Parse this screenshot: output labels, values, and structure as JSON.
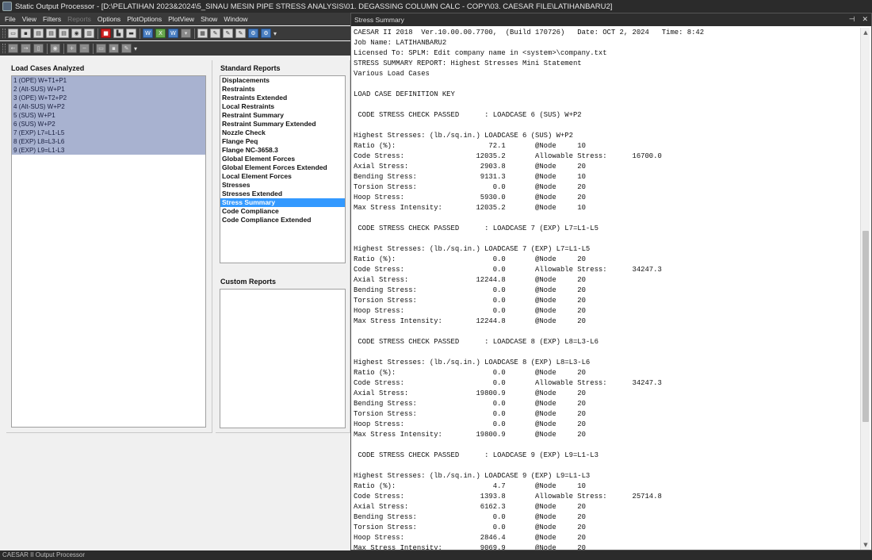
{
  "window": {
    "title": "Static Output Processor - [D:\\PELATIHAN 2023&2024\\5_SINAU MESIN PIPE STRESS ANALYSIS\\01. DEGASSING COLUMN CALC - COPY\\03. CAESAR FILE\\LATIHANBARU2]"
  },
  "menu": [
    {
      "label": "File",
      "enabled": true
    },
    {
      "label": "View",
      "enabled": true
    },
    {
      "label": "Filters",
      "enabled": true
    },
    {
      "label": "Reports",
      "enabled": false
    },
    {
      "label": "Options",
      "enabled": true
    },
    {
      "label": "PlotOptions",
      "enabled": true
    },
    {
      "label": "PlotView",
      "enabled": true
    },
    {
      "label": "Show",
      "enabled": true
    },
    {
      "label": "Window",
      "enabled": true
    }
  ],
  "load_cases": {
    "title": "Load Cases Analyzed",
    "items": [
      "1 (OPE) W+T1+P1",
      "2 (Alt-SUS) W+P1",
      "3 (OPE) W+T2+P2",
      "4 (Alt-SUS) W+P2",
      "5 (SUS) W+P1",
      "6 (SUS) W+P2",
      "7 (EXP) L7=L1-L5",
      "8 (EXP) L8=L3-L6",
      "9 (EXP) L9=L1-L3"
    ]
  },
  "standard_reports": {
    "title": "Standard Reports",
    "selected": "Stress Summary",
    "items": [
      "Displacements",
      "Restraints",
      "Restraints Extended",
      "Local Restraints",
      "Restraint Summary",
      "Restraint Summary Extended",
      "Nozzle Check",
      "Flange Peq",
      "Flange NC-3658.3",
      "Global Element Forces",
      "Global Element Forces Extended",
      "Local Element Forces",
      "Stresses",
      "Stresses Extended",
      "Stress Summary",
      "Code Compliance",
      "Code Compliance Extended"
    ]
  },
  "custom_reports": {
    "title": "Custom Reports"
  },
  "report_window": {
    "title": "Stress Summary",
    "pin_glyph": "⊣",
    "close_glyph": "✕",
    "scroll": {
      "position": 0.62,
      "visible_fraction": 0.38
    },
    "lines": [
      "CAESAR II 2018  Ver.10.00.00.7700,  (Build 170726)   Date: OCT 2, 2024   Time: 8:42",
      "Job Name: LATIHANBARU2",
      "Licensed To: SPLM: Edit company name in <system>\\company.txt",
      "STRESS SUMMARY REPORT: Highest Stresses Mini Statement",
      "Various Load Cases",
      "",
      "LOAD CASE DEFINITION KEY",
      "",
      " CODE STRESS CHECK PASSED      : LOADCASE 6 (SUS) W+P2",
      "",
      "Highest Stresses: (lb./sq.in.) LOADCASE 6 (SUS) W+P2",
      "Ratio (%):                      72.1       @Node     10",
      "Code Stress:                 12035.2       Allowable Stress:      16700.0",
      "Axial Stress:                 2903.8       @Node     20",
      "Bending Stress:               9131.3       @Node     10",
      "Torsion Stress:                  0.0       @Node     20",
      "Hoop Stress:                  5930.0       @Node     20",
      "Max Stress Intensity:        12035.2       @Node     10",
      "",
      " CODE STRESS CHECK PASSED      : LOADCASE 7 (EXP) L7=L1-L5",
      "",
      "Highest Stresses: (lb./sq.in.) LOADCASE 7 (EXP) L7=L1-L5",
      "Ratio (%):                       0.0       @Node     20",
      "Code Stress:                     0.0       Allowable Stress:      34247.3",
      "Axial Stress:                12244.8       @Node     20",
      "Bending Stress:                  0.0       @Node     20",
      "Torsion Stress:                  0.0       @Node     20",
      "Hoop Stress:                     0.0       @Node     20",
      "Max Stress Intensity:        12244.8       @Node     20",
      "",
      " CODE STRESS CHECK PASSED      : LOADCASE 8 (EXP) L8=L3-L6",
      "",
      "Highest Stresses: (lb./sq.in.) LOADCASE 8 (EXP) L8=L3-L6",
      "Ratio (%):                       0.0       @Node     20",
      "Code Stress:                     0.0       Allowable Stress:      34247.3",
      "Axial Stress:                19800.9       @Node     20",
      "Bending Stress:                  0.0       @Node     20",
      "Torsion Stress:                  0.0       @Node     20",
      "Hoop Stress:                     0.0       @Node     20",
      "Max Stress Intensity:        19800.9       @Node     20",
      "",
      " CODE STRESS CHECK PASSED      : LOADCASE 9 (EXP) L9=L1-L3",
      "",
      "Highest Stresses: (lb./sq.in.) LOADCASE 9 (EXP) L9=L1-L3",
      "Ratio (%):                       4.7       @Node     10",
      "Code Stress:                  1393.8       Allowable Stress:      25714.8",
      "Axial Stress:                 6162.3       @Node     20",
      "Bending Stress:                  0.0       @Node     20",
      "Torsion Stress:                  0.0       @Node     20",
      "Hoop Stress:                  2846.4       @Node     20",
      "Max Stress Intensity:         9069.9       @Node     20"
    ]
  },
  "statusbar": {
    "text": "CAESAR II Output Processor"
  },
  "toolbar": {
    "row1": [
      {
        "icon": "open-folder-icon",
        "glyph": "▭",
        "style": ""
      },
      {
        "icon": "save-icon",
        "glyph": "▪",
        "style": ""
      },
      {
        "icon": "document-icon",
        "glyph": "▤",
        "style": ""
      },
      {
        "icon": "document-icon",
        "glyph": "▤",
        "style": ""
      },
      {
        "icon": "document-icon",
        "glyph": "▤",
        "style": ""
      },
      {
        "icon": "binoculars-icon",
        "glyph": "◉",
        "style": ""
      },
      {
        "icon": "report-icon",
        "glyph": "▥",
        "style": ""
      },
      {
        "icon": "stop-icon",
        "glyph": "■",
        "style": "red"
      },
      {
        "icon": "chart-icon",
        "glyph": "▙",
        "style": ""
      },
      {
        "icon": "print-icon",
        "glyph": "▬",
        "style": ""
      },
      {
        "icon": "word-icon",
        "glyph": "W",
        "style": "blue"
      },
      {
        "icon": "excel-icon",
        "glyph": "X",
        "style": "green"
      },
      {
        "icon": "word-doc-icon",
        "glyph": "W",
        "style": "blue"
      },
      {
        "icon": "dropdown-icon",
        "glyph": "▾",
        "style": "gray"
      },
      {
        "icon": "report-icon",
        "glyph": "▦",
        "style": ""
      },
      {
        "icon": "edit-icon",
        "glyph": "✎",
        "style": ""
      },
      {
        "icon": "edit-icon",
        "glyph": "✎",
        "style": ""
      },
      {
        "icon": "edit-icon",
        "glyph": "✎",
        "style": ""
      },
      {
        "icon": "tools-icon",
        "glyph": "⚙",
        "style": "blue"
      },
      {
        "icon": "tools-icon",
        "glyph": "⚙",
        "style": "blue"
      }
    ],
    "row2": [
      {
        "icon": "back-arrow-icon",
        "glyph": "←",
        "style": "gray"
      },
      {
        "icon": "forward-arrow-icon",
        "glyph": "→",
        "style": "gray"
      },
      {
        "icon": "page-icon",
        "glyph": "▯",
        "style": "gray"
      },
      {
        "icon": "binoculars-icon",
        "glyph": "◉",
        "style": "gray"
      },
      {
        "icon": "plus-icon",
        "glyph": "+",
        "style": "gray"
      },
      {
        "icon": "minus-icon",
        "glyph": "−",
        "style": "gray"
      },
      {
        "icon": "window-icon",
        "glyph": "▭",
        "style": "gray"
      },
      {
        "icon": "save-icon",
        "glyph": "▪",
        "style": "gray"
      },
      {
        "icon": "edit-icon",
        "glyph": "✎",
        "style": "gray"
      }
    ]
  }
}
